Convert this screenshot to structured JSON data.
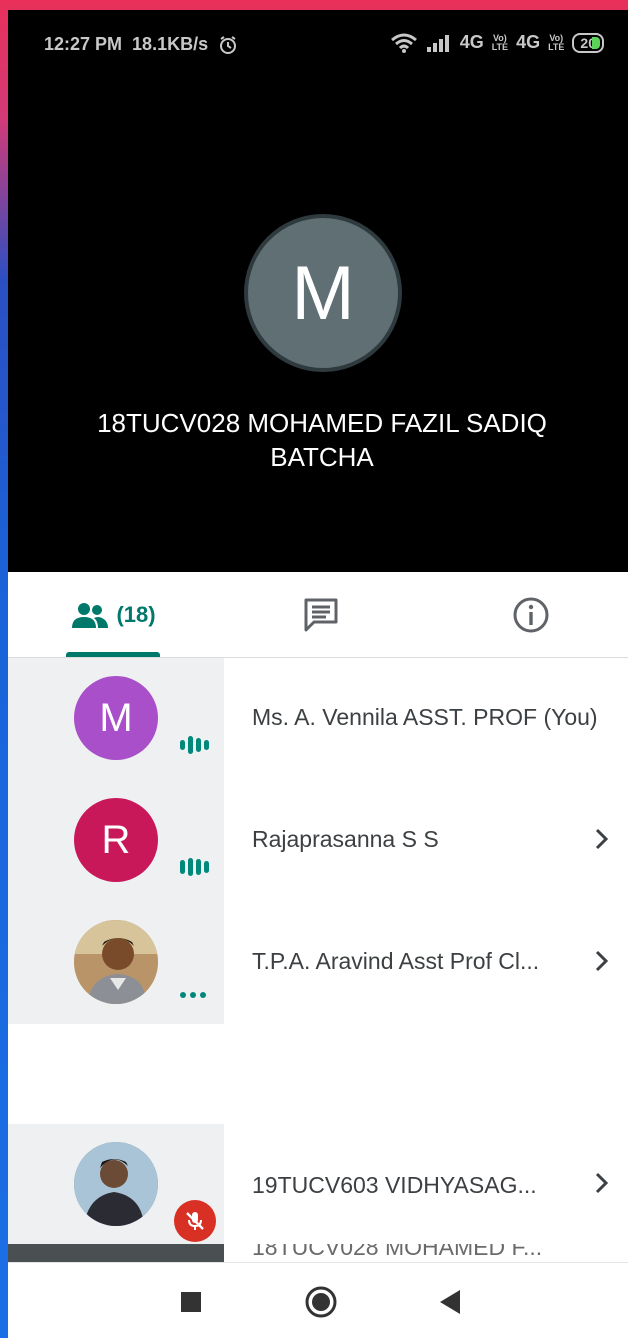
{
  "status_bar": {
    "time": "12:27 PM",
    "speed": "18.1KB/s",
    "network_1": "4G",
    "network_2": "4G",
    "lte_top": "Vo)",
    "lte_bottom": "LTE",
    "battery": "20"
  },
  "video": {
    "avatar_letter": "M",
    "speaker_name": "18TUCV028 MOHAMED FAZIL SADIQ BATCHA",
    "avatar_color": "#5f6f74"
  },
  "tabs": {
    "people_count": "(18)",
    "accent": "#00796b"
  },
  "participants": [
    {
      "letter": "M",
      "name": "Ms. A. Vennila ASST. PROF (You)",
      "color": "#a94fc9",
      "status": "speaking"
    },
    {
      "letter": "R",
      "name": "Rajaprasanna S S",
      "color": "#c8185a",
      "status": "speaking"
    },
    {
      "letter": "",
      "name": "T.P.A. Aravind Asst Prof Cl...",
      "color": "#c9a27a",
      "status": "idle"
    },
    {
      "letter": "",
      "name": "19TUCV603 VIDHYASAG...",
      "color": "#6a8fb0",
      "status": "muted"
    }
  ],
  "partial_row": {
    "name": "18TUCV028 MOHAMED F..."
  }
}
